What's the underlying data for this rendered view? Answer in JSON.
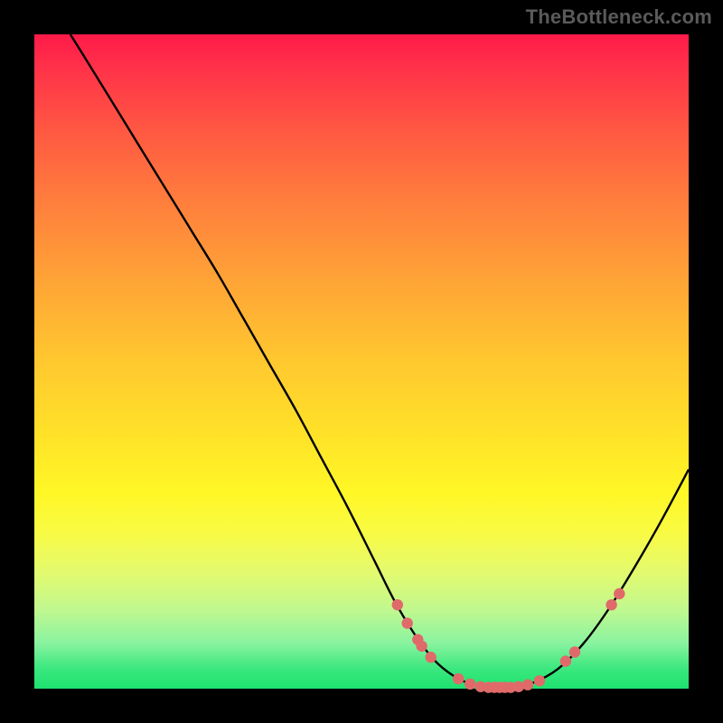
{
  "watermark": "TheBottleneck.com",
  "colors": {
    "background": "#000000",
    "curve": "#000000",
    "dots": "#e06a6a"
  },
  "chart_data": {
    "type": "line",
    "title": "",
    "xlabel": "",
    "ylabel": "",
    "xlim": [
      0,
      100
    ],
    "ylim": [
      0,
      100
    ],
    "grid": false,
    "legend": false,
    "series": [
      {
        "name": "curve",
        "x": [
          5.5,
          8,
          12,
          16,
          20,
          24,
          28,
          32,
          36,
          40,
          44,
          48,
          52,
          55,
          58,
          61,
          64,
          67,
          70,
          73,
          76,
          80,
          84,
          88,
          92,
          96,
          100
        ],
        "y": [
          100,
          96,
          89.5,
          83,
          76.5,
          70,
          63.5,
          56.5,
          49.5,
          42.5,
          35,
          27.5,
          19.5,
          13.5,
          8.5,
          4.5,
          2,
          0.6,
          0.2,
          0.2,
          0.8,
          3,
          7,
          12.5,
          19,
          26,
          33.5
        ]
      }
    ],
    "markers": [
      {
        "x": 55.5,
        "y": 12.8
      },
      {
        "x": 57.0,
        "y": 10.0
      },
      {
        "x": 58.6,
        "y": 7.5
      },
      {
        "x": 59.2,
        "y": 6.5
      },
      {
        "x": 60.6,
        "y": 4.8
      },
      {
        "x": 64.8,
        "y": 1.5
      },
      {
        "x": 66.6,
        "y": 0.7
      },
      {
        "x": 68.2,
        "y": 0.3
      },
      {
        "x": 69.4,
        "y": 0.2
      },
      {
        "x": 70.3,
        "y": 0.2
      },
      {
        "x": 71.1,
        "y": 0.2
      },
      {
        "x": 71.9,
        "y": 0.2
      },
      {
        "x": 72.8,
        "y": 0.2
      },
      {
        "x": 74.0,
        "y": 0.3
      },
      {
        "x": 75.4,
        "y": 0.6
      },
      {
        "x": 77.2,
        "y": 1.2
      },
      {
        "x": 81.2,
        "y": 4.2
      },
      {
        "x": 82.6,
        "y": 5.6
      },
      {
        "x": 88.2,
        "y": 12.8
      },
      {
        "x": 89.4,
        "y": 14.5
      }
    ]
  }
}
